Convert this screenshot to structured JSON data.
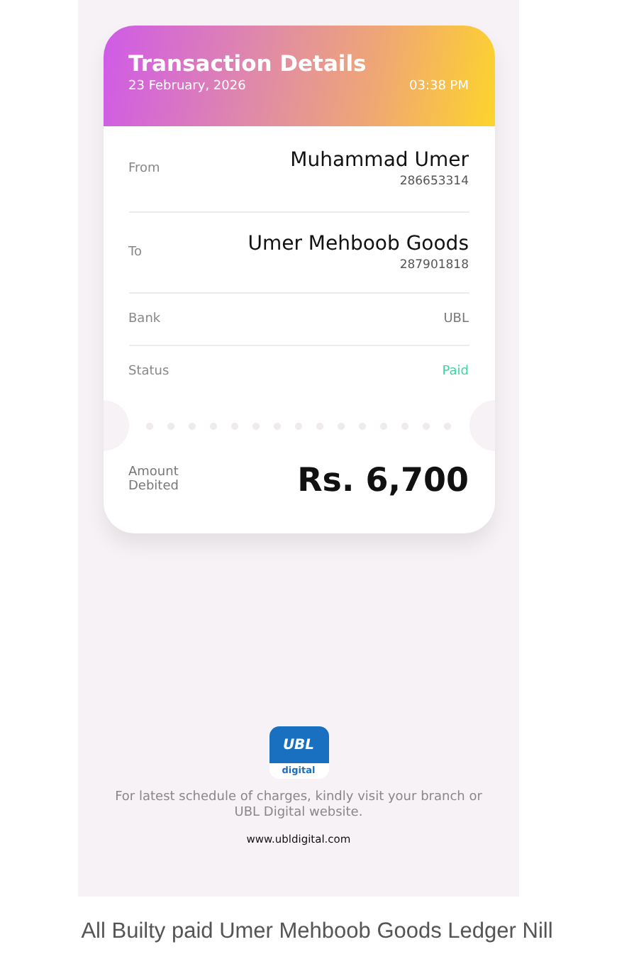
{
  "header": {
    "title": "Transaction Details",
    "date": "23 February, 2026",
    "time": "03:38 PM"
  },
  "rows": [
    {
      "kind": "party",
      "label": "From",
      "value": "Muhammad Umer",
      "sub": "286653314"
    },
    {
      "kind": "party",
      "label": "To",
      "value": "Umer Mehboob Goods",
      "sub": "287901818"
    },
    {
      "kind": "plain",
      "label": "Bank",
      "value": "UBL"
    },
    {
      "kind": "status",
      "label": "Status",
      "value": "Paid",
      "color": "#3dd6a0"
    }
  ],
  "amount": {
    "label": "Amount\nDebited",
    "value": "Rs. 6,700"
  },
  "logo": {
    "mark": "UBL",
    "word": "digital"
  },
  "footer": {
    "note": "For latest schedule of charges, kindly visit your branch or UBL Digital website.",
    "url": "www.ubldigital.com"
  },
  "caption": "All Builty paid Umer Mehboob Goods Ledger Nill"
}
